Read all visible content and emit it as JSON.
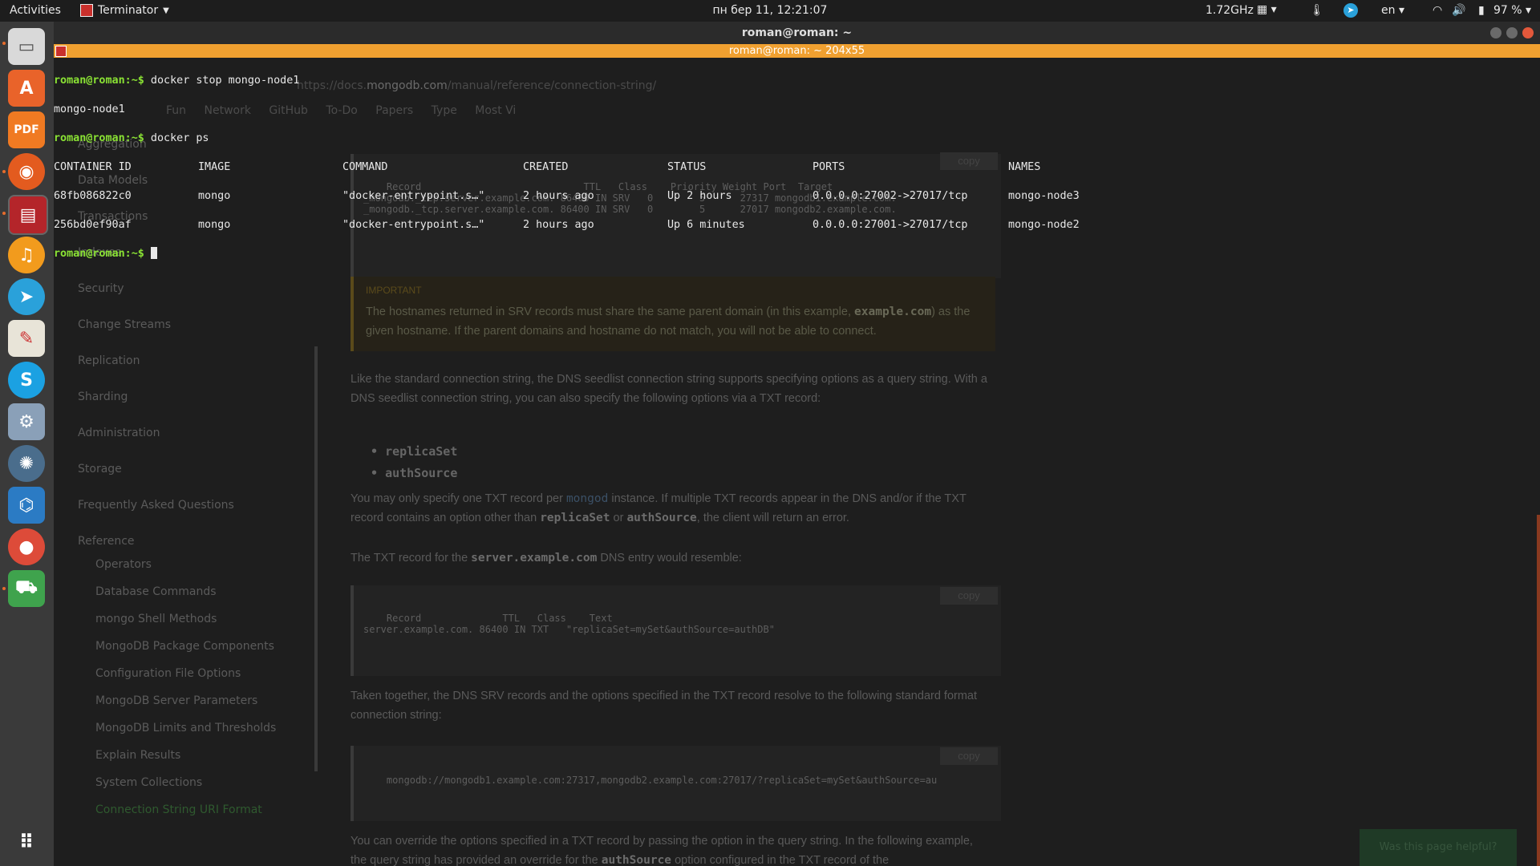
{
  "topbar": {
    "activities": "Activities",
    "app_name": "Terminator",
    "clock": "пн бер 11, 12:21:07",
    "cpu": "1.72GHz",
    "lang": "en",
    "battery": "97 %"
  },
  "dock": {
    "items": [
      "files",
      "software-center",
      "pdf-editor",
      "firefox",
      "terminator",
      "rhythmbox",
      "telegram",
      "text-editor",
      "skype",
      "system-tools",
      "gnome-shell",
      "vscode",
      "chrome",
      "mongodb-compass"
    ]
  },
  "window": {
    "title": "roman@roman: ~",
    "tab_title": "roman@roman: ~ 204x55"
  },
  "terminal": {
    "prompt": "roman@roman:~$",
    "cmd1": " docker stop mongo-node1",
    "out1": "mongo-node1",
    "cmd2": " docker ps",
    "headers": {
      "container_id": "CONTAINER ID",
      "image": "IMAGE",
      "command": "COMMAND",
      "created": "CREATED",
      "status": "STATUS",
      "ports": "PORTS",
      "names": "NAMES"
    },
    "rows": [
      {
        "container_id": "68fb086822c0",
        "image": "mongo",
        "command": "\"docker-entrypoint.s…\"",
        "created": "2 hours ago",
        "status": "Up 2 hours",
        "ports": "0.0.0.0:27002->27017/tcp",
        "names": "mongo-node3"
      },
      {
        "container_id": "256bd0ef90af",
        "image": "mongo",
        "command": "\"docker-entrypoint.s…\"",
        "created": "2 hours ago",
        "status": "Up 6 minutes",
        "ports": "0.0.0.0:27001->27017/tcp",
        "names": "mongo-node2"
      }
    ],
    "cmd3": " "
  },
  "browser": {
    "url_prefix": "https://docs.",
    "url_domain": "mongodb.com",
    "url_path": "/manual/reference/connection-string/",
    "bookmarks": [
      "Fun",
      "Network",
      "GitHub",
      "To-Do",
      "Papers",
      "Type",
      "Most Vi"
    ],
    "sidebar": [
      "Aggregation",
      "Data Models",
      "Transactions",
      "Indexes",
      "Security",
      "Change Streams",
      "Replication",
      "Sharding",
      "Administration",
      "Storage",
      "Frequently Asked Questions",
      "Reference"
    ],
    "sidebar_sub": [
      "Operators",
      "Database Commands",
      "mongo Shell Methods",
      "MongoDB Package Components",
      "Configuration File Options",
      "MongoDB Server Parameters",
      "MongoDB Limits and Thresholds",
      "Explain Results",
      "System Collections",
      "Connection String URI Format"
    ],
    "copy": "copy",
    "srv_table": "Record                            TTL   Class    Priority Weight Port  Target\n_mongodb._tcp.server.example.com. 86400 IN SRV   0        5      27317 mongodb1.example.com.\n_mongodb._tcp.server.example.com. 86400 IN SRV   0        5      27017 mongodb2.example.com.",
    "important_label": "IMPORTANT",
    "important_a": "The hostnames returned in SRV records must share the same parent domain (in this example, ",
    "important_code": "example.com",
    "important_b": ") as the given hostname. If the parent domains and hostname do not match, you will not be able to connect.",
    "p1": "Like the standard connection string, the DNS seedlist connection string supports specifying options as a query string. With a DNS seedlist connection string, you can also specify the following options via a TXT record:",
    "bullet1": "replicaSet",
    "bullet2": "authSource",
    "p2_a": "You may only specify one TXT record per ",
    "p2_link": "mongod",
    "p2_b": " instance. If multiple TXT records appear in the DNS and/or if the TXT record contains an option other than ",
    "p2_code1": "replicaSet",
    "p2_c": " or ",
    "p2_code2": "authSource",
    "p2_d": ", the client will return an error.",
    "p3_a": "The TXT record for the ",
    "p3_code": "server.example.com",
    "p3_b": " DNS entry would resemble:",
    "txt_table": "Record              TTL   Class    Text\nserver.example.com. 86400 IN TXT   \"replicaSet=mySet&authSource=authDB\"",
    "p4": "Taken together, the DNS SRV records and the options specified in the TXT record resolve to the following standard format connection string:",
    "conn_string": "mongodb://mongodb1.example.com:27317,mongodb2.example.com:27017/?replicaSet=mySet&authSource=au",
    "p5_a": "You can override the options specified in a TXT record by passing the option in the query string. In the following example, the query string has provided an override for the ",
    "p5_code": "authSource",
    "p5_b": " option configured in the TXT record of the",
    "feedback": "Was this page helpful?"
  },
  "colors": {
    "prompt_green": "#8ae234",
    "tab_orange": "#f0a030",
    "topbar": "#1d1d1d"
  }
}
